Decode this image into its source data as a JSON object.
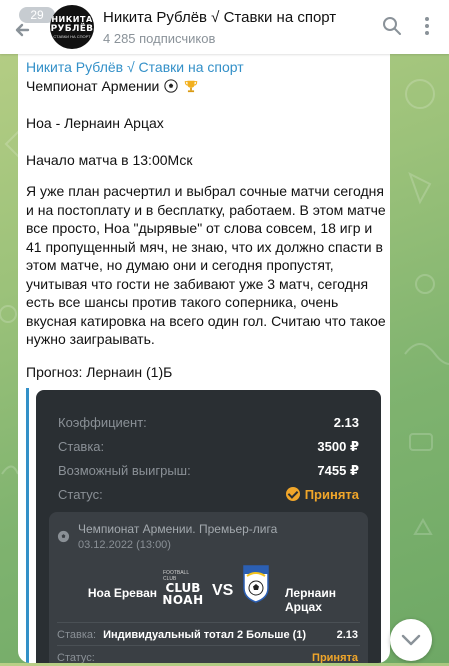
{
  "header": {
    "unread_count": "29",
    "avatar_text": [
      "НИКИТА",
      "РУБЛЁВ",
      "СТАВКИ НА СПОРТ"
    ],
    "channel_title": "Никита Рублёв √ Ставки на спорт",
    "subscribers": "4 285 подписчиков"
  },
  "message": {
    "author": "Никита Рублёв √ Ставки на спорт",
    "championship": "Чемпионат Армении",
    "match": "Ноа - Лернаин Арцах",
    "kickoff": "Начало матча в 13:00Мск",
    "body": "Я уже план расчертил и выбрал сочные матчи сегодня и на постоплату и в бесплатку, работаем. В этом матче все просто, Ноа \"дырявые\" от слова совсем, 18 игр и 41 пропущенный мяч, не знаю, что их должно спасти в этом матче, но думаю они и сегодня пропустят, учитывая что гости не забивают уже 3 матч, сегодня есть все шансы против такого соперника, очень вкусная катировка на всего один гол. Считаю что такое нужно заиграывать.",
    "forecast": "Прогноз: Лернаин (1)Б"
  },
  "bet_card": {
    "coef_label": "Коэффициент:",
    "coef_value": "2.13",
    "stake_label": "Ставка:",
    "stake_value": "3500 ₽",
    "win_label": "Возможный выигрыш:",
    "win_value": "7455 ₽",
    "status_label": "Статус:",
    "status_value": "Принята",
    "league": "Чемпионат Армении. Премьер-лига",
    "date": "03.12.2022 (13:00)",
    "home_team": "Ноа Ереван",
    "home_logo_text": [
      "FOOTBALL CLUB",
      "CLUB",
      "NOAH"
    ],
    "vs": "VS",
    "away_team": "Лернаин Арцах",
    "bet_label": "Ставка:",
    "bet_desc": "Индивидуальный тотал 2 Больше (1)",
    "bet_odds": "2.13",
    "bet_status_label": "Статус:",
    "bet_status": "Принята"
  },
  "colors": {
    "accent": "#3390c8",
    "card_bg": "#2a2f33",
    "accepted": "#f0a62a"
  }
}
